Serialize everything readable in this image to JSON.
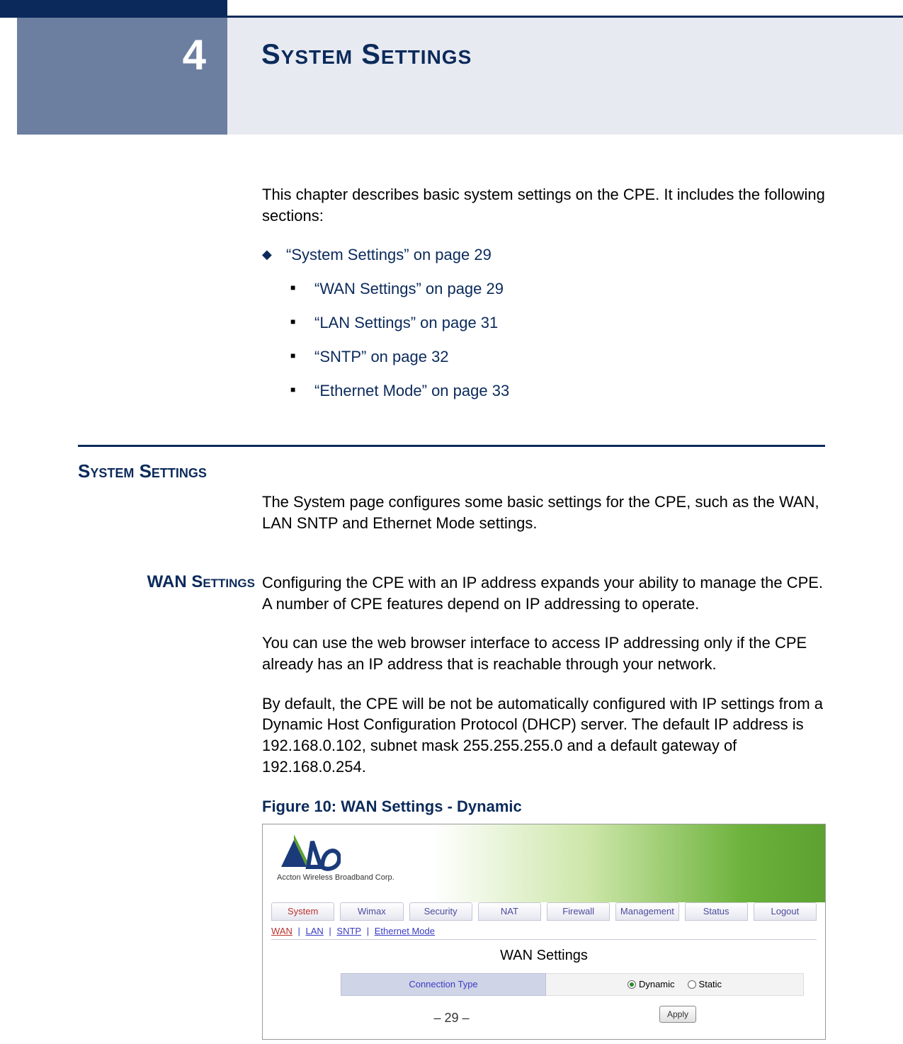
{
  "chapter": {
    "number": "4",
    "title": "System Settings"
  },
  "intro": "This chapter describes basic system settings on the CPE. It includes the following sections:",
  "toc": {
    "l1": "“System Settings” on page 29",
    "l2": [
      "“WAN Settings” on page 29",
      "“LAN Settings” on page 31",
      "“SNTP” on page 32",
      "“Ethernet Mode” on page 33"
    ]
  },
  "section": {
    "heading": "System Settings",
    "body": "The System page configures some basic settings for the CPE, such as the WAN, LAN SNTP and Ethernet Mode settings."
  },
  "subsection": {
    "heading": "WAN Settings",
    "p1": "Configuring the CPE with an IP address expands your ability to manage the CPE. A number of CPE features depend on IP addressing to operate.",
    "p2": "You can use the web browser interface to access IP addressing only if the CPE already has an IP address that is reachable through your network.",
    "p3": "By default, the CPE will be not be automatically configured with IP settings from a Dynamic Host Configuration Protocol (DHCP) server. The default IP address is 192.168.0.102, subnet mask 255.255.255.0 and a default gateway of 192.168.0.254.",
    "figure_caption": "Figure 10:  WAN Settings - Dynamic"
  },
  "screenshot": {
    "logo_text": "Accton Wireless Broadband Corp.",
    "tabs": [
      "System",
      "Wimax",
      "Security",
      "NAT",
      "Firewall",
      "Management",
      "Status",
      "Logout"
    ],
    "active_tab_index": 0,
    "subnav": {
      "items": [
        "WAN",
        "LAN",
        "SNTP",
        "Ethernet Mode"
      ],
      "active_index": 0,
      "sep": " | "
    },
    "panel_title": "WAN Settings",
    "row_label": "Connection Type",
    "radios": [
      {
        "label": "Dynamic",
        "selected": true
      },
      {
        "label": "Static",
        "selected": false
      }
    ],
    "apply": "Apply"
  },
  "page_footer": "–  29  –"
}
